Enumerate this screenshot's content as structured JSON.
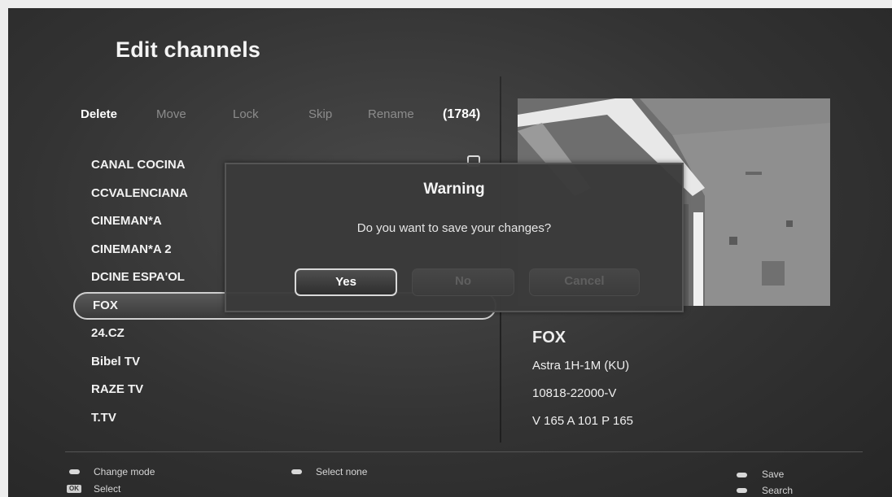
{
  "screen": {
    "title": "Edit channels"
  },
  "modes": {
    "delete": "Delete",
    "move": "Move",
    "lock": "Lock",
    "skip": "Skip",
    "rename": "Rename",
    "count": "(1784)"
  },
  "channels": [
    {
      "name": "CANAL COCINA"
    },
    {
      "name": "CCVALENCIANA"
    },
    {
      "name": "CINEMAN*A"
    },
    {
      "name": "CINEMAN*A 2"
    },
    {
      "name": "DCINE ESPA'OL"
    },
    {
      "name": "FOX",
      "selected": true
    },
    {
      "name": "24.CZ"
    },
    {
      "name": "Bibel TV"
    },
    {
      "name": "RAZE TV"
    },
    {
      "name": "T.TV"
    }
  ],
  "info": {
    "name": "FOX",
    "satellite": "Astra 1H-1M (KU)",
    "transponder": "10818-22000-V",
    "pids": "V 165 A 101 P 165"
  },
  "dialog": {
    "title": "Warning",
    "message": "Do you want to save your changes?",
    "yes": "Yes",
    "no": "No",
    "cancel": "Cancel"
  },
  "footer": {
    "change_mode": "Change mode",
    "select": "Select",
    "ok_key": "OK",
    "select_none": "Select none",
    "save": "Save",
    "search": "Search"
  }
}
